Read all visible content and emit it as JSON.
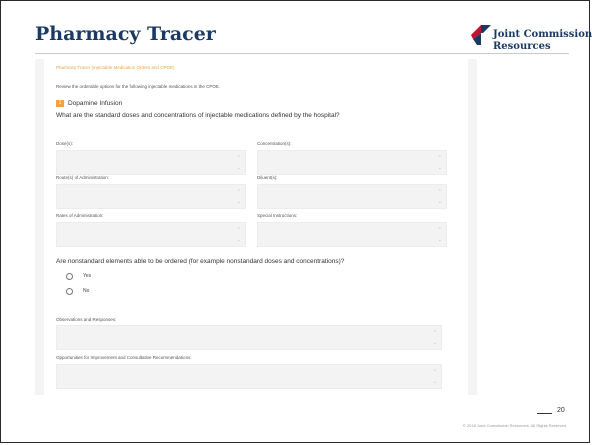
{
  "slide": {
    "title": "Pharmacy Tracer",
    "page_number": "20",
    "copyright": "© 2018 Joint Commission Resources. All Rights Reserved."
  },
  "logo": {
    "line1": "Joint Commission",
    "line2": "Resources",
    "colors": {
      "red": "#c8102e",
      "blue": "#1b3a63"
    }
  },
  "form": {
    "breadcrumb": "Pharmacy Tracer (Injectable Medication Orders and CPOE)",
    "intro": "Review the orderable options for the following injectable medications in the CPOE.",
    "section": {
      "number": "1",
      "title": "Dopamine Infusion"
    },
    "question1": "What are the standard doses and concentrations of injectable medications defined by the hospital?",
    "fields": {
      "doses": {
        "label": "Dose(s):",
        "value": ""
      },
      "concentrations": {
        "label": "Concentration(s):",
        "value": ""
      },
      "routes": {
        "label": "Route(s) of Administration:",
        "value": ""
      },
      "diluent": {
        "label": "Diluent(s):",
        "value": ""
      },
      "rates": {
        "label": "Rates of Administration:",
        "value": ""
      },
      "special": {
        "label": "Special Instructions:",
        "value": ""
      },
      "observations": {
        "label": "Observations and Responses:",
        "value": ""
      },
      "opportunities": {
        "label": "Opportunities for Improvement and Consultative Recommendations:",
        "value": ""
      }
    },
    "question2": "Are nonstandard elements able to be ordered (for example nonstandard doses and concentrations)?",
    "options": [
      "Yes",
      "No"
    ],
    "colors": {
      "accent": "#f2a33a",
      "title": "#1b3a63"
    }
  }
}
